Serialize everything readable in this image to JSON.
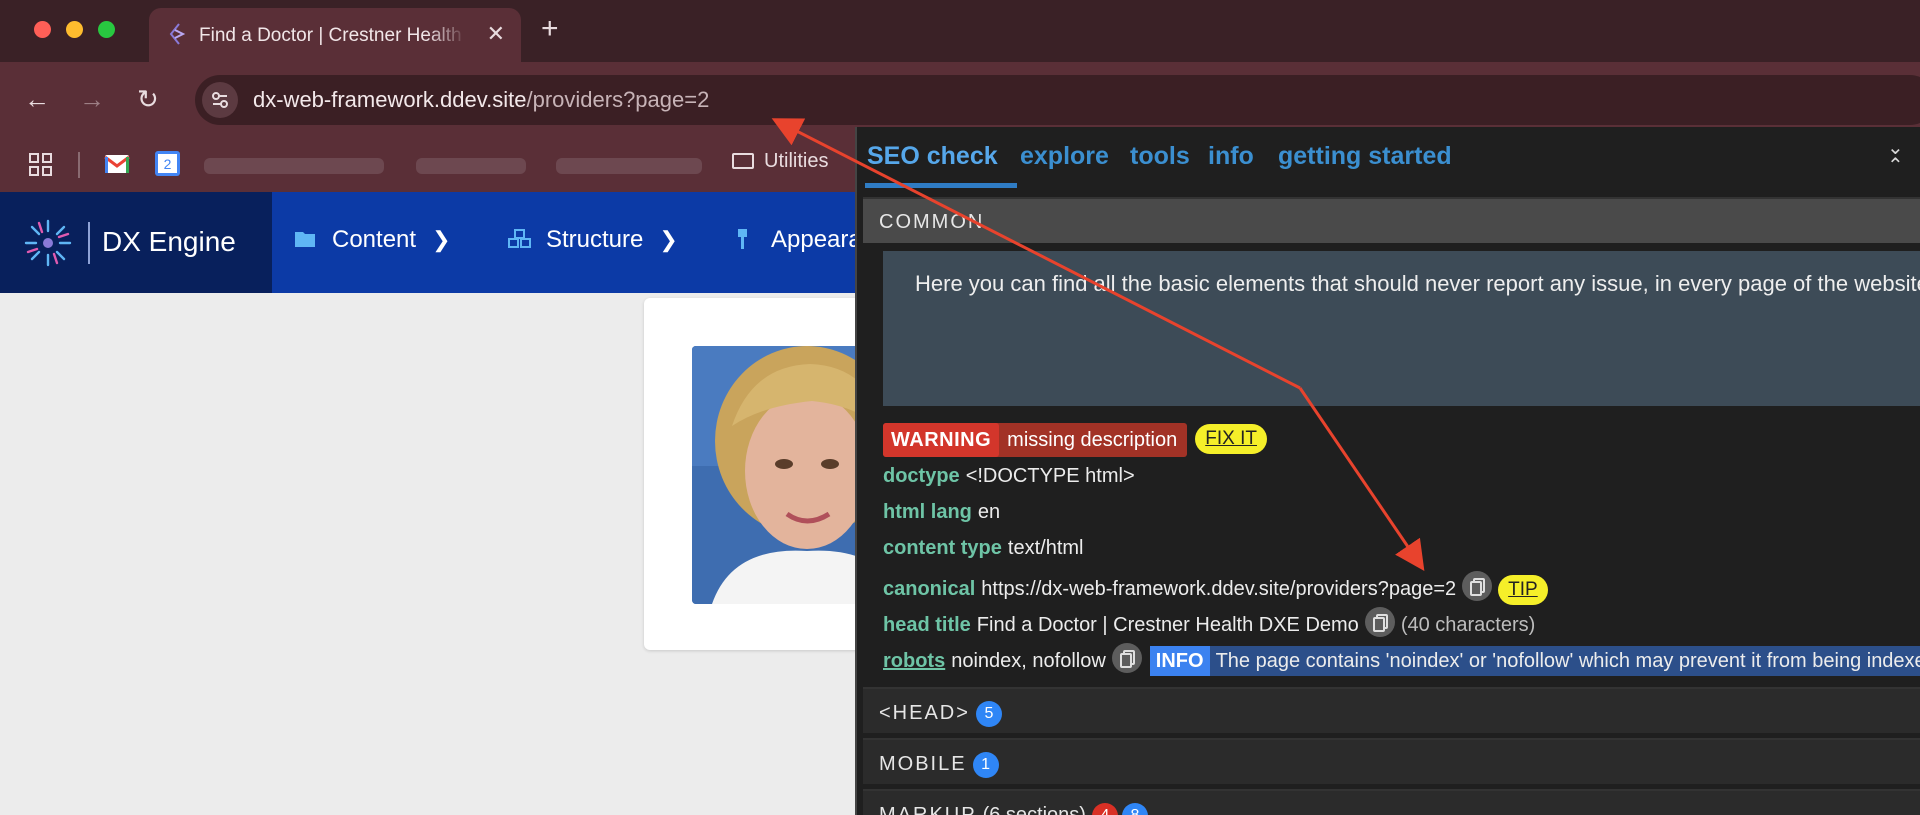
{
  "browser": {
    "tab_title": "Find a Doctor | Crestner Health DXE Demo",
    "new_tab": "+",
    "close": "✕",
    "url_host": "dx-web-framework.ddev.site",
    "url_path": "/providers?page=2",
    "back": "←",
    "forward": "→",
    "reload": "↻",
    "bookmarks": {
      "calendar_day": "2",
      "folder": "Utilities"
    }
  },
  "admin": {
    "brand": "DX Engine",
    "menu": [
      "Content",
      "Structure",
      "Appearance"
    ]
  },
  "seo": {
    "tabs": [
      "SEO check",
      "explore",
      "tools",
      "info",
      "getting started"
    ],
    "collapse": "⌄",
    "common": {
      "title": "COMMON",
      "description": "Here you can find all the basic elements that should never report any issue, in every page of the website."
    },
    "warning": {
      "label": "WARNING",
      "text": "missing description",
      "fix": "FIX IT"
    },
    "doctype": {
      "key": "doctype",
      "value": "<!DOCTYPE html>"
    },
    "lang": {
      "key": "html lang",
      "value": "en"
    },
    "content_type": {
      "key": "content type",
      "value": "text/html"
    },
    "canonical": {
      "key": "canonical",
      "value": "https://dx-web-framework.ddev.site/providers?page=2",
      "tip": "TIP"
    },
    "head_title": {
      "key": "head title",
      "value": "Find a Doctor | Crestner Health DXE Demo",
      "chars": "(40 characters)"
    },
    "robots": {
      "key": "robots",
      "value": "noindex, nofollow",
      "info_label": "INFO",
      "info_text": "The page contains 'noindex' or 'nofollow' which may prevent it from being indexed."
    },
    "sections": [
      {
        "title": "<HEAD>",
        "badge": "5"
      },
      {
        "title": "MOBILE",
        "badge": "1"
      },
      {
        "title": "MARKUP",
        "count": "(6 sections)",
        "badge_red": "4",
        "badge_blue": "8"
      }
    ]
  },
  "colors": {
    "accent": "#56a7ea",
    "warning": "#d3362b",
    "tip": "#f5ef29",
    "annotation": "#e8432d"
  }
}
